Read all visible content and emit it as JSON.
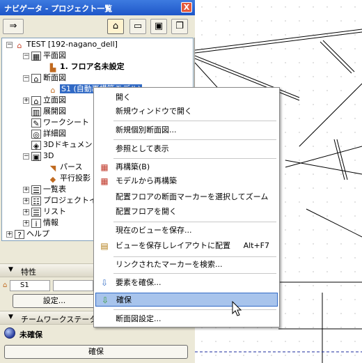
{
  "window": {
    "title": "ナビゲータ - プロジェクト一覧",
    "close_label": "X"
  },
  "toolbar": {
    "first_icon": "⇒"
  },
  "tree": {
    "root": "TEST [192-nagano_dell]",
    "floor_plans": "平面図",
    "floor_1": "1. フロア名未設定",
    "sections": "断面図",
    "section_s1": "S1 (自動再構築モデル)",
    "elevations": "立面図",
    "interior_elevations": "展開図",
    "worksheets": "ワークシート",
    "details": "詳細図",
    "documents_3d": "3Dドキュメント",
    "three_d": "3D",
    "perspective": "パース",
    "parallel": "平行投影",
    "schedules": "一覧表",
    "project_index": "プロジェクトインデックス",
    "lists": "リスト",
    "info": "情報",
    "help": "ヘルプ"
  },
  "properties": {
    "header": "特性",
    "id_value": "S1",
    "settings_button": "設定..."
  },
  "teamwork": {
    "header": "チームワークステータス",
    "status": "未確保",
    "reserve_button": "確保"
  },
  "context_menu": {
    "items": [
      {
        "label": "開く"
      },
      {
        "label": "新規ウィンドウで開く"
      },
      {
        "label": "新規個別断面図..."
      },
      {
        "label": "参照として表示"
      },
      {
        "label": "再構築(B)"
      },
      {
        "label": "モデルから再構築"
      },
      {
        "label": "配置フロアの断面マーカーを選択してズーム"
      },
      {
        "label": "配置フロアを開く"
      },
      {
        "label": "現在のビューを保存..."
      },
      {
        "label": "ビューを保存しレイアウトに配置",
        "shortcut": "Alt+F7"
      },
      {
        "label": "リンクされたマーカーを検索..."
      },
      {
        "label": "要素を確保..."
      },
      {
        "label": "確保"
      },
      {
        "label": "断面図設定..."
      }
    ]
  },
  "colors": {
    "titlebar": "#1e56c8",
    "selection": "#316ac5",
    "highlight": "#a8c4ec"
  }
}
